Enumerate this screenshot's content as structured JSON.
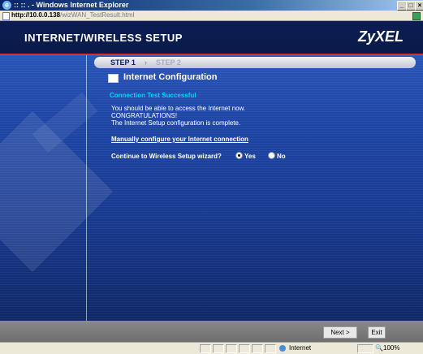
{
  "window": {
    "title": ":: :: . - Windows Internet Explorer",
    "minimize": "_",
    "maximize": "□",
    "close": "×"
  },
  "address": {
    "url_host": "http://10.0.0.138",
    "url_path": "/wizWAN_TestResult.html"
  },
  "header": {
    "title": "INTERNET/WIRELESS SETUP",
    "brand": "ZyXEL"
  },
  "steps": {
    "step1": "STEP 1",
    "arrow": "›",
    "step2": "STEP 2"
  },
  "section": {
    "title": "Internet Configuration",
    "status": "Connection Test Successful",
    "message_lines": [
      "You should be able to access the Internet now.",
      "CONGRATULATIONS!",
      "The Internet Setup configuration is complete."
    ],
    "manual_link": "Manually configure your Internet connection",
    "question": "Continue to Wireless Setup wizard?",
    "options": [
      {
        "label": "Yes",
        "checked": true
      },
      {
        "label": "No",
        "checked": false
      }
    ]
  },
  "buttons": {
    "next": "Next >",
    "exit": "Exit"
  },
  "statusbar": {
    "zone": "Internet",
    "zoom": "100%"
  },
  "colors": {
    "header_bg": "#0c1d55",
    "accent_red": "#d0332a",
    "status_cyan": "#00d8f0"
  }
}
